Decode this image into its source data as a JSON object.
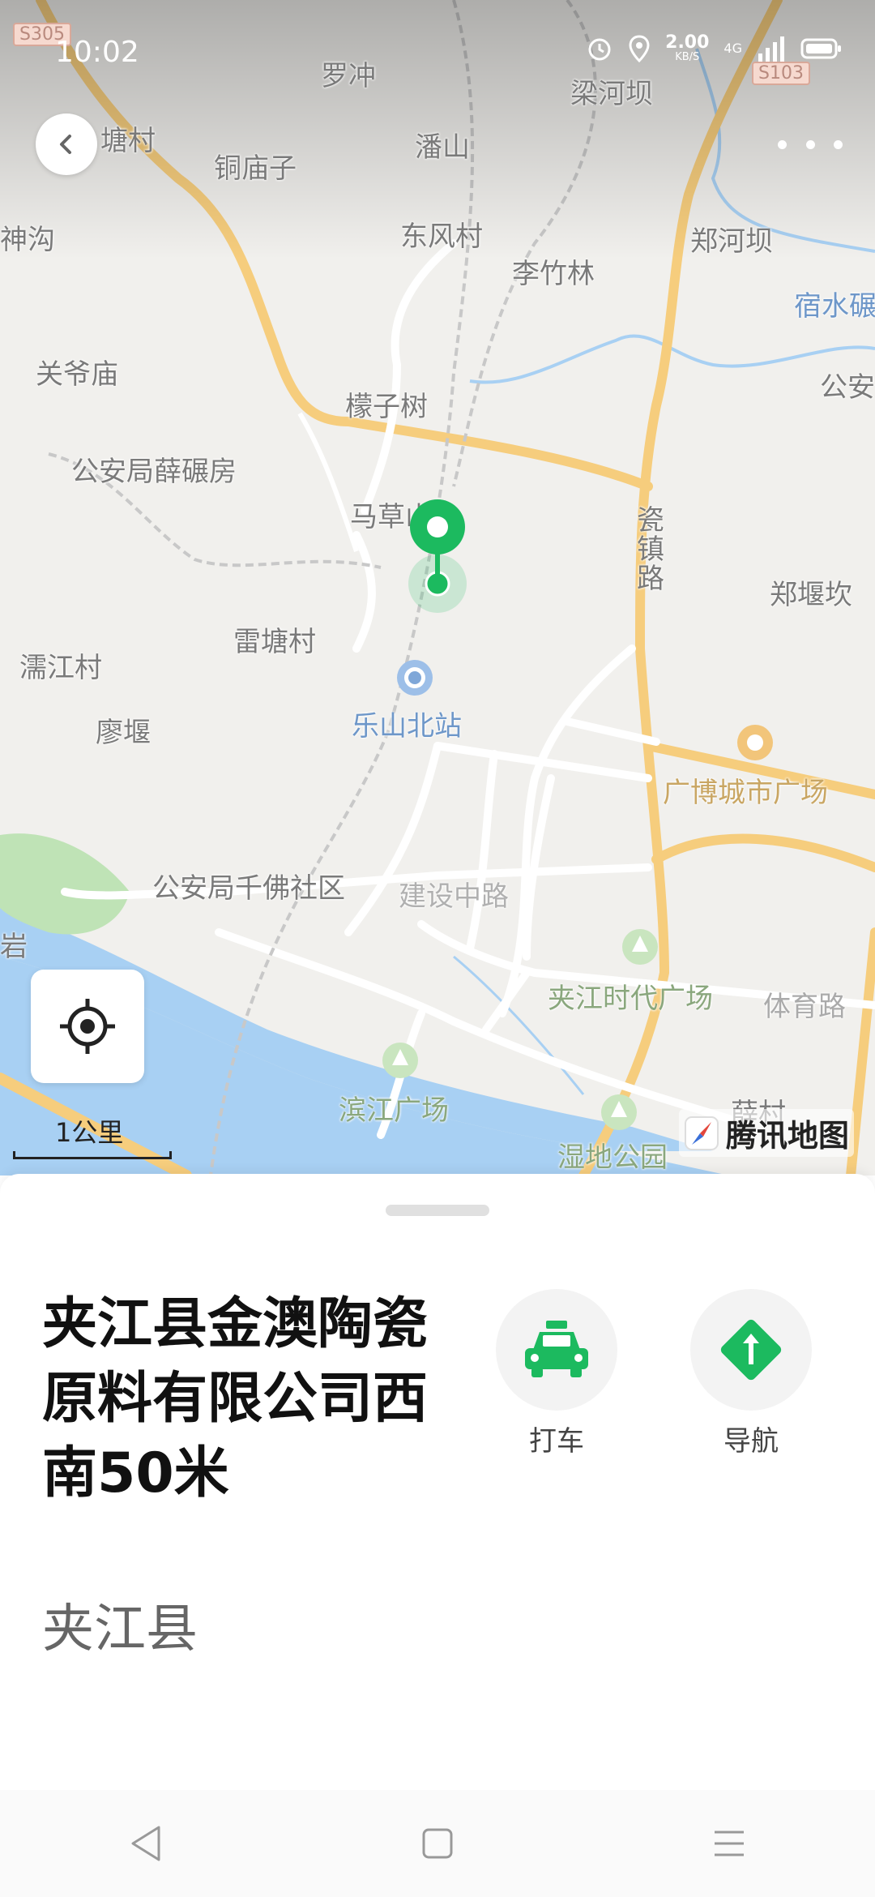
{
  "status_bar": {
    "time": "10:02",
    "net_speed_value": "2.00",
    "net_speed_unit": "KB/S",
    "network": "4G"
  },
  "map": {
    "road_tags": [
      "S305",
      "S103"
    ],
    "labels": {
      "luochong": "罗冲",
      "lianghebai": "梁河坝",
      "tangcun": "塘村",
      "tongmiaozi": "铜庙子",
      "panshan": "潘山",
      "shengou": "神沟",
      "dongfengcun": "东风村",
      "zhenghebai": "郑河坝",
      "lizhulin": "李竹林",
      "sushui": "宿水碾",
      "guanyemiao": "关爷庙",
      "gongan_east": "公安",
      "mengzishu": "檬子树",
      "gonganju_xue": "公安局薛碾房",
      "macao": "马草山",
      "cizhenlu": "瓷镇路",
      "zhengyankan": "郑堰坎",
      "leitangcun": "雷塘村",
      "yanjiangcun": "濡江村",
      "liaoyan": "廖堰",
      "leshan_north": "乐山北站",
      "guangbo": "广博城市广场",
      "gonganju_qianfo": "公安局千佛社区",
      "jianshe_road": "建设中路",
      "jiajiang_times": "夹江时代广场",
      "tiyu_road": "体育路",
      "yan": "岩",
      "binjiang": "滨江广场",
      "xuecun": "薛村",
      "wetland": "湿地公园"
    },
    "scale_label": "1公里",
    "logo_text": "腾讯地图"
  },
  "sheet": {
    "title": "夹江县金澳陶瓷原料有限公司西南50米",
    "subtitle": "夹江县",
    "actions": {
      "taxi_label": "打车",
      "navigate_label": "导航"
    }
  },
  "colors": {
    "accent_green": "#1cba5f",
    "road_yellow": "#f6cd7d",
    "water_blue": "#a8d0f3",
    "park_green": "#bfe3b6"
  }
}
